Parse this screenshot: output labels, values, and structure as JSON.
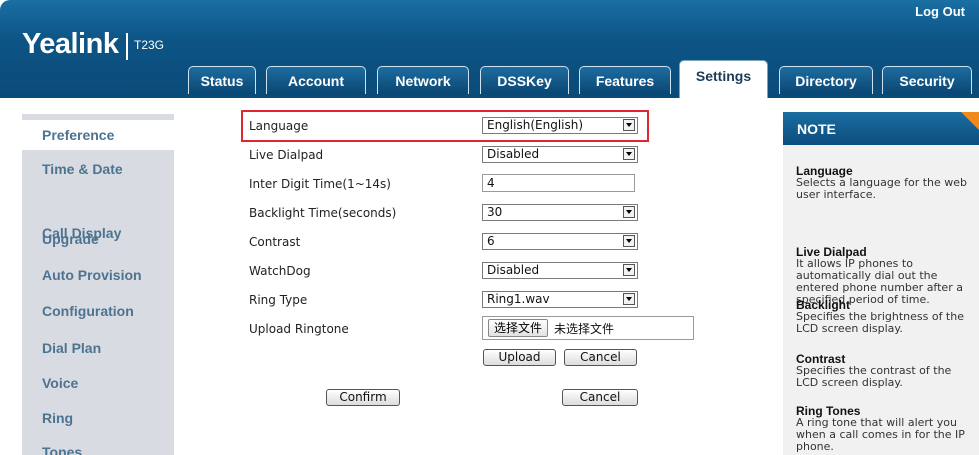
{
  "header": {
    "logout": "Log Out",
    "brand": "Yealink",
    "model": "T23G"
  },
  "tabs": [
    {
      "label": "Status"
    },
    {
      "label": "Account"
    },
    {
      "label": "Network"
    },
    {
      "label": "DSSKey"
    },
    {
      "label": "Features"
    },
    {
      "label": "Settings"
    },
    {
      "label": "Directory"
    },
    {
      "label": "Security"
    }
  ],
  "sidebar": {
    "items": [
      {
        "label": "Preference"
      },
      {
        "label": "Time & Date"
      },
      {
        "label": "Call Display"
      },
      {
        "label": "Upgrade"
      },
      {
        "label": "Auto Provision"
      },
      {
        "label": "Configuration"
      },
      {
        "label": "Dial Plan"
      },
      {
        "label": "Voice"
      },
      {
        "label": "Ring"
      },
      {
        "label": "Tones"
      }
    ]
  },
  "form": {
    "language": {
      "label": "Language",
      "value": "English(English)"
    },
    "live_dialpad": {
      "label": "Live Dialpad",
      "value": "Disabled"
    },
    "inter_digit": {
      "label": "Inter Digit Time(1~14s)",
      "value": "4"
    },
    "backlight": {
      "label": "Backlight Time(seconds)",
      "value": "30"
    },
    "contrast": {
      "label": "Contrast",
      "value": "6"
    },
    "watchdog": {
      "label": "WatchDog",
      "value": "Disabled"
    },
    "ring_type": {
      "label": "Ring Type",
      "value": "Ring1.wav"
    },
    "upload_ringtone": {
      "label": "Upload Ringtone",
      "choose_file": "选择文件",
      "no_file": "未选择文件"
    },
    "upload_button": "Upload",
    "cancel_upload_button": "Cancel",
    "confirm_button": "Confirm",
    "cancel_button": "Cancel"
  },
  "note": {
    "title": "NOTE",
    "items": [
      {
        "heading": "Language",
        "lines": [
          "Selects a language for the web",
          "user interface."
        ]
      },
      {
        "heading": "Live Dialpad",
        "lines": [
          "It allows IP phones to",
          "automatically dial out the",
          "entered phone number after a",
          "specified period of time."
        ]
      },
      {
        "heading": "Backlight",
        "lines": [
          "Specifies the brightness of the",
          "LCD screen display."
        ]
      },
      {
        "heading": "Contrast",
        "lines": [
          "Specifies the contrast of the",
          "LCD screen display."
        ]
      },
      {
        "heading": "Ring Tones",
        "lines": [
          "A ring tone that will alert you",
          "when a call comes in for the IP",
          "phone."
        ]
      }
    ]
  },
  "colors": {
    "header_blue": "#0d5586",
    "sidebar_text": "#4d7391",
    "highlight_red": "#e0262e",
    "note_corner": "#f08a1d"
  }
}
